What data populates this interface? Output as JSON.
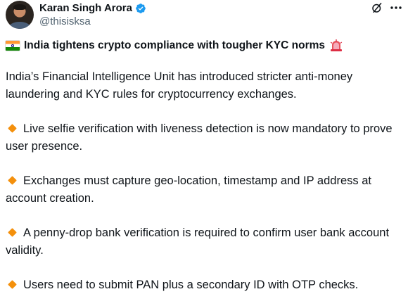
{
  "author": {
    "display_name": "Karan Singh Arora",
    "handle": "@thisisksa",
    "verified": true,
    "verified_color": "#1d9bf0"
  },
  "icons": {
    "grok": "grok-icon",
    "more": "more-options-icon",
    "flag": "india-flag-icon",
    "siren": "police-light-icon",
    "bullet": "orange-diamond-icon",
    "bullet_color": "#f4900c"
  },
  "post": {
    "title": "India tightens crypto compliance with tougher KYC norms",
    "intro": "India’s Financial Intelligence Unit has introduced stricter anti-money laundering and KYC rules for cryptocurrency exchanges.",
    "bullets": [
      "Live selfie verification with liveness detection is now mandatory to prove user presence.",
      "Exchanges must capture geo-location, timestamp and IP address at account creation.",
      "A penny-drop bank verification is required to confirm user bank account validity.",
      "Users need to submit PAN plus a secondary ID with OTP checks."
    ]
  }
}
